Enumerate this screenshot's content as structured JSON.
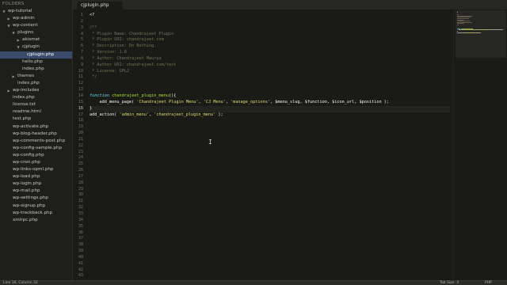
{
  "sidebar": {
    "header": "FOLDERS",
    "items": [
      {
        "label": "wp-tutorial",
        "depth": 0,
        "arrow": "open"
      },
      {
        "label": "wp-admin",
        "depth": 1,
        "arrow": "closed"
      },
      {
        "label": "wp-content",
        "depth": 1,
        "arrow": "open"
      },
      {
        "label": "plugins",
        "depth": 2,
        "arrow": "open"
      },
      {
        "label": "akismet",
        "depth": 3,
        "arrow": "closed"
      },
      {
        "label": "cjplugin",
        "depth": 3,
        "arrow": "open"
      },
      {
        "label": "cjplugin.php",
        "depth": 4,
        "arrow": "",
        "selected": true
      },
      {
        "label": "hello.php",
        "depth": 3,
        "arrow": ""
      },
      {
        "label": "index.php",
        "depth": 3,
        "arrow": ""
      },
      {
        "label": "themes",
        "depth": 2,
        "arrow": "closed"
      },
      {
        "label": "index.php",
        "depth": 2,
        "arrow": ""
      },
      {
        "label": "wp-includes",
        "depth": 1,
        "arrow": "closed"
      },
      {
        "label": "index.php",
        "depth": 1,
        "arrow": ""
      },
      {
        "label": "license.txt",
        "depth": 1,
        "arrow": ""
      },
      {
        "label": "readme.html",
        "depth": 1,
        "arrow": ""
      },
      {
        "label": "test.php",
        "depth": 1,
        "arrow": ""
      },
      {
        "label": "wp-activate.php",
        "depth": 1,
        "arrow": ""
      },
      {
        "label": "wp-blog-header.php",
        "depth": 1,
        "arrow": ""
      },
      {
        "label": "wp-comments-post.php",
        "depth": 1,
        "arrow": ""
      },
      {
        "label": "wp-config-sample.php",
        "depth": 1,
        "arrow": ""
      },
      {
        "label": "wp-config.php",
        "depth": 1,
        "arrow": ""
      },
      {
        "label": "wp-cron.php",
        "depth": 1,
        "arrow": ""
      },
      {
        "label": "wp-links-opml.php",
        "depth": 1,
        "arrow": ""
      },
      {
        "label": "wp-load.php",
        "depth": 1,
        "arrow": ""
      },
      {
        "label": "wp-login.php",
        "depth": 1,
        "arrow": ""
      },
      {
        "label": "wp-mail.php",
        "depth": 1,
        "arrow": ""
      },
      {
        "label": "wp-settings.php",
        "depth": 1,
        "arrow": ""
      },
      {
        "label": "wp-signup.php",
        "depth": 1,
        "arrow": ""
      },
      {
        "label": "wp-trackback.php",
        "depth": 1,
        "arrow": ""
      },
      {
        "label": "xmlrpc.php",
        "depth": 1,
        "arrow": ""
      }
    ]
  },
  "tabs": [
    {
      "label": "cjplugin.php"
    }
  ],
  "editor": {
    "active_line": 16,
    "line_count": 43,
    "lines": [
      [
        {
          "t": "<?",
          "c": "tag"
        }
      ],
      [],
      [
        {
          "t": "/**",
          "c": "comment"
        }
      ],
      [
        {
          "t": " * Plugin Name: Chandrajeet Plugin",
          "c": "comment"
        }
      ],
      [
        {
          "t": " * Plugin URI: chandrajeet.com",
          "c": "comment"
        }
      ],
      [
        {
          "t": " * Description: Do Nothing.",
          "c": "comment"
        }
      ],
      [
        {
          "t": " * Version: 1.0",
          "c": "comment"
        }
      ],
      [
        {
          "t": " * Author: Chandrajeet Maurya",
          "c": "comment"
        }
      ],
      [
        {
          "t": " * Author URI: chandrajeet.com/test",
          "c": "comment"
        }
      ],
      [
        {
          "t": " * License: GPL2",
          "c": "comment"
        }
      ],
      [
        {
          "t": " */",
          "c": "comment"
        }
      ],
      [],
      [],
      [
        {
          "t": "function",
          "c": "keyword"
        },
        {
          "t": " ",
          "c": "punc"
        },
        {
          "t": "chandrajeet_plugin_menu",
          "c": "fn"
        },
        {
          "t": "(){",
          "c": "punc"
        }
      ],
      [
        {
          "t": "    ",
          "c": "punc"
        },
        {
          "t": "add_menu_page",
          "c": "punc"
        },
        {
          "t": "( ",
          "c": "punc"
        },
        {
          "t": "'Chandrajeet Plugin Menu'",
          "c": "str"
        },
        {
          "t": ", ",
          "c": "punc"
        },
        {
          "t": "'CJ Menu'",
          "c": "str"
        },
        {
          "t": ", ",
          "c": "punc"
        },
        {
          "t": "'manage_options'",
          "c": "str"
        },
        {
          "t": ", $menu_slug, $function, $icon_url, $position );",
          "c": "var"
        }
      ],
      [
        {
          "t": "}",
          "c": "punc"
        }
      ],
      [
        {
          "t": "add_action",
          "c": "punc"
        },
        {
          "t": "( ",
          "c": "punc"
        },
        {
          "t": "'admin_menu'",
          "c": "str"
        },
        {
          "t": ", ",
          "c": "punc"
        },
        {
          "t": "'chandrajeet_plugin_menu'",
          "c": "str"
        },
        {
          "t": " );",
          "c": "punc"
        }
      ]
    ],
    "cursor_glyph": "I"
  },
  "status": {
    "left": "Line 16, Column 32",
    "tab_size": "Tab Size: 4",
    "syntax": "PHP"
  },
  "colors": {
    "background": "#1a1b16",
    "comment": "#75715e",
    "keyword": "#66d9ef",
    "function": "#a6e22e",
    "string": "#e6db74",
    "selection": "#3a4a6a"
  }
}
